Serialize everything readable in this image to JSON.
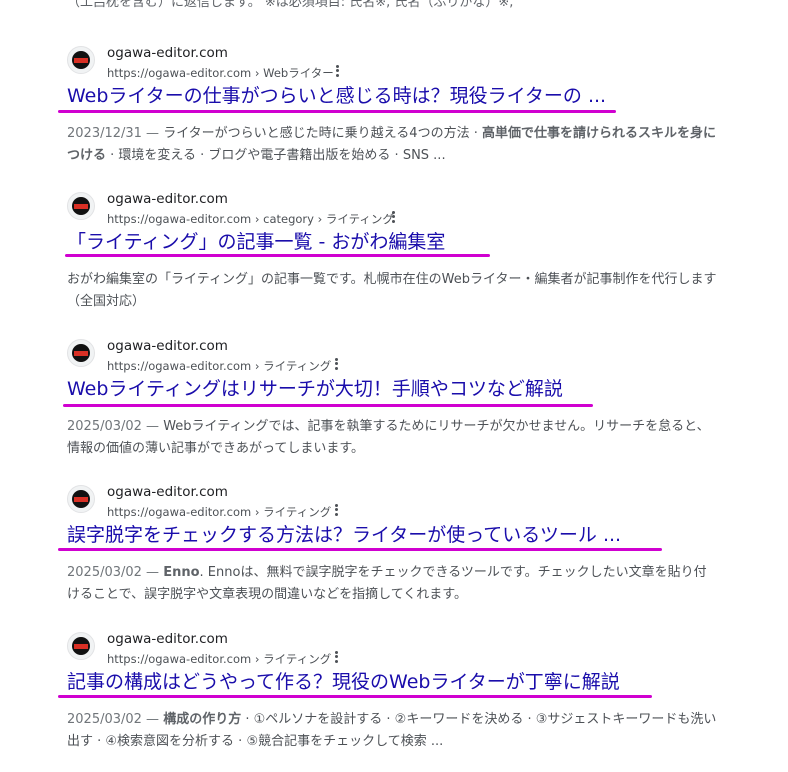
{
  "top_snippet": "（工吕枕を含む）に返信します。 ※は必須項目: 氏名※, 氏名（ふりがな）※,",
  "results": [
    {
      "site_name": "ogawa-editor.com",
      "url": "https://ogawa-editor.com › Webライター",
      "title": "Webライターの仕事がつらいと感じる時は？現役ライターの ...",
      "date": "2023/12/31 —",
      "snippet_a": "ライターがつらいと感じた時に乗り越える4つの方法 · ",
      "snippet_bold": "高単価で仕事を請けられるスキルを身につける",
      "snippet_b": " · 環境を変える · ブログや電子書籍出版を始める · SNS ..."
    },
    {
      "site_name": "ogawa-editor.com",
      "url": "https://ogawa-editor.com › category › ライティング",
      "title": "「ライティング」の記事一覧 - おがわ編集室",
      "date": "",
      "snippet_a": "おがわ編集室の「ライティング」の記事一覧です。札幌市在住のWebライター・編集者が記事制作を代行します（全国対応）",
      "snippet_bold": "",
      "snippet_b": ""
    },
    {
      "site_name": "ogawa-editor.com",
      "url": "https://ogawa-editor.com › ライティング",
      "title": "Webライティングはリサーチが大切！手順やコツなど解説",
      "date": "2025/03/02 —",
      "snippet_a": "Webライティングでは、記事を執筆するためにリサーチが欠かせません。リサーチを怠ると、情報の価値の薄い記事ができあがってしまいます。",
      "snippet_bold": "",
      "snippet_b": ""
    },
    {
      "site_name": "ogawa-editor.com",
      "url": "https://ogawa-editor.com › ライティング",
      "title": "誤字脱字をチェックする方法は？ライターが使っているツール ...",
      "date": "2025/03/02 —",
      "snippet_a": "",
      "snippet_bold": "Enno",
      "snippet_b": ". Ennoは、無料で誤字脱字をチェックできるツールです。チェックしたい文章を貼り付けることで、誤字脱字や文章表現の間違いなどを指摘してくれます。"
    },
    {
      "site_name": "ogawa-editor.com",
      "url": "https://ogawa-editor.com › ライティング",
      "title": "記事の構成はどうやって作る？現役のWebライターが丁寧に解説",
      "date": "2025/03/02 —",
      "snippet_a": "",
      "snippet_bold": "構成の作り方",
      "snippet_b": " · ①ペルソナを設計する · ②キーワードを決める · ③サジェストキーワードも洗い出す · ④検索意図を分析する · ⑤競合記事をチェックして検索 ..."
    }
  ],
  "colors": {
    "title_link": "#1a0dab",
    "annotation_underline": "#d000d0"
  }
}
